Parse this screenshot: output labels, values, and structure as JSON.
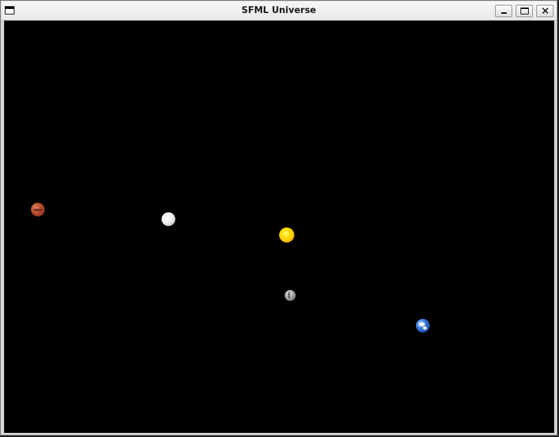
{
  "window": {
    "title": "SFML Universe",
    "menu_icon": "window-menu-icon",
    "controls": {
      "minimize": "minimize-icon",
      "maximize": "maximize-icon",
      "close": "close-icon",
      "close_glyph": "✕"
    }
  },
  "scene": {
    "background": "#000000",
    "bodies": [
      {
        "name": "mars",
        "color": "#b5482b"
      },
      {
        "name": "white-moon",
        "color": "#ececec"
      },
      {
        "name": "sun",
        "color": "#ffd800"
      },
      {
        "name": "gray-moon",
        "color": "#9a9a9a"
      },
      {
        "name": "earth",
        "color": "#2f6fd6"
      }
    ]
  }
}
